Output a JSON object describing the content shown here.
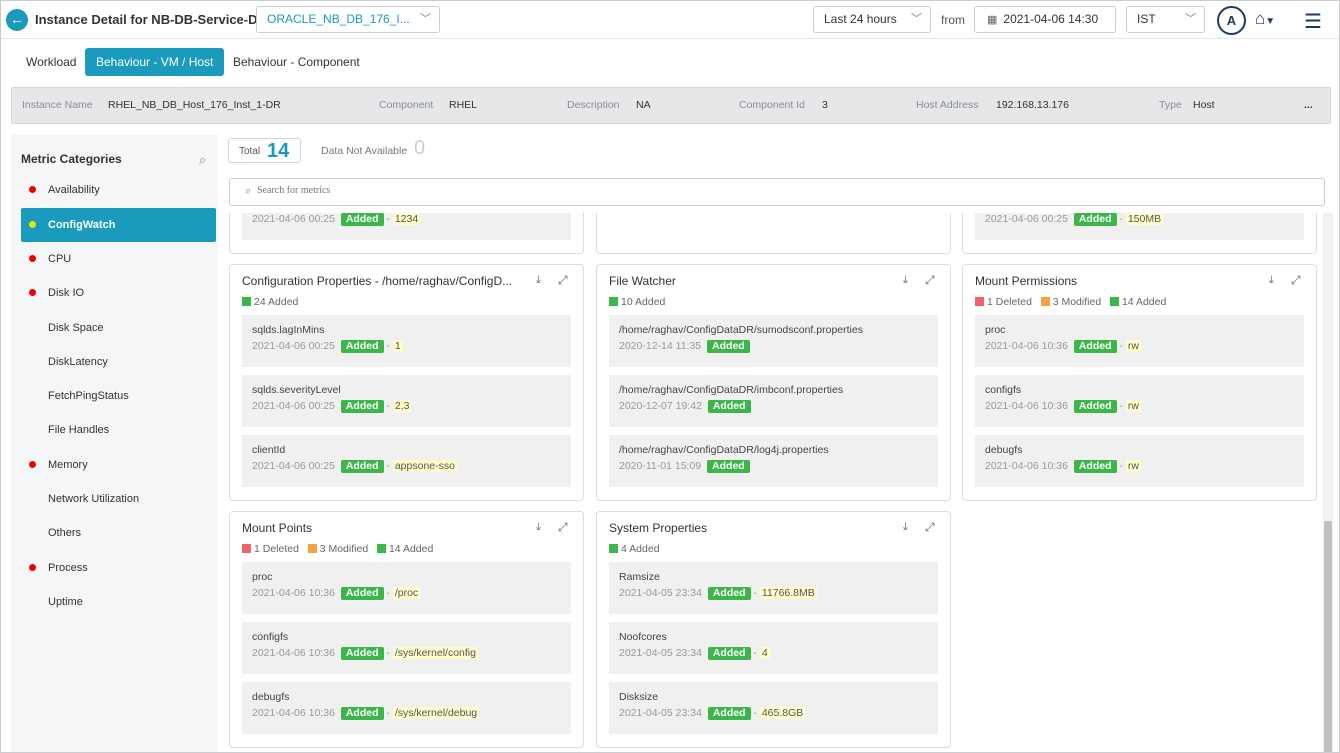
{
  "header": {
    "title": "Instance Detail for NB-DB-Service-DR",
    "instance_select": "ORACLE_NB_DB_176_I...",
    "time_range": "Last 24 hours",
    "from_label": "from",
    "from_date": "2021-04-06 14:30",
    "timezone": "IST",
    "avatar": "A"
  },
  "tabs": [
    "Workload",
    "Behaviour - VM / Host",
    "Behaviour - Component"
  ],
  "info": {
    "instance_name_key": "Instance Name",
    "instance_name": "RHEL_NB_DB_Host_176_Inst_1-DR",
    "component_key": "Component",
    "component": "RHEL",
    "description_key": "Description",
    "description": "NA",
    "component_id_key": "Component Id",
    "component_id": "3",
    "host_address_key": "Host Address",
    "host_address": "192.168.13.176",
    "type_key": "Type",
    "type": "Host",
    "more": "..."
  },
  "sidebar": {
    "title": "Metric Categories",
    "items": [
      {
        "label": "Availability",
        "dot": true
      },
      {
        "label": "ConfigWatch",
        "dot": true
      },
      {
        "label": "CPU",
        "dot": true
      },
      {
        "label": "Disk IO",
        "dot": true
      },
      {
        "label": "Disk Space",
        "dot": false
      },
      {
        "label": "DiskLatency",
        "dot": false
      },
      {
        "label": "FetchPingStatus",
        "dot": false
      },
      {
        "label": "File Handles",
        "dot": false
      },
      {
        "label": "Memory",
        "dot": true
      },
      {
        "label": "Network Utilization",
        "dot": false
      },
      {
        "label": "Others",
        "dot": false
      },
      {
        "label": "Process",
        "dot": true
      },
      {
        "label": "Uptime",
        "dot": false
      }
    ]
  },
  "summary": {
    "total_label": "Total",
    "total": "14",
    "dna_label": "Data Not Available",
    "dna": "0"
  },
  "search": {
    "placeholder": "Search for metrics"
  },
  "partial": [
    {
      "time": "2021-04-06 00:25",
      "badge": "Added",
      "value": "1234"
    },
    {
      "time": "2021-04-06 00:25",
      "badge": "Added",
      "value": "150MB"
    }
  ],
  "cards": {
    "config_props": {
      "title": "Configuration Properties - /home/raghav/ConfigD...",
      "added": "24 Added",
      "items": [
        {
          "name": "sqlds.lagInMins",
          "time": "2021-04-06 00:25",
          "badge": "Added",
          "value": "1"
        },
        {
          "name": "sqlds.severityLevel",
          "time": "2021-04-06 00:25",
          "badge": "Added",
          "value": "2,3"
        },
        {
          "name": "clientId",
          "time": "2021-04-06 00:25",
          "badge": "Added",
          "value": "appsone-sso"
        }
      ]
    },
    "file_watcher": {
      "title": "File Watcher",
      "added": "10 Added",
      "items": [
        {
          "name": "/home/raghav/ConfigDataDR/sumodsconf.properties",
          "time": "2020-12-14 11:35",
          "badge": "Added"
        },
        {
          "name": "/home/raghav/ConfigDataDR/imbconf.properties",
          "time": "2020-12-07 19:42",
          "badge": "Added"
        },
        {
          "name": "/home/raghav/ConfigDataDR/log4j.properties",
          "time": "2020-11-01 15:09",
          "badge": "Added"
        }
      ]
    },
    "mount_permissions": {
      "title": "Mount Permissions",
      "deleted": "1 Deleted",
      "modified": "3 Modified",
      "added": "14 Added",
      "items": [
        {
          "name": "proc",
          "time": "2021-04-06 10:36",
          "badge": "Added",
          "value": "rw"
        },
        {
          "name": "configfs",
          "time": "2021-04-06 10:36",
          "badge": "Added",
          "value": "rw"
        },
        {
          "name": "debugfs",
          "time": "2021-04-06 10:36",
          "badge": "Added",
          "value": "rw"
        }
      ]
    },
    "mount_points": {
      "title": "Mount Points",
      "deleted": "1 Deleted",
      "modified": "3 Modified",
      "added": "14 Added",
      "items": [
        {
          "name": "proc",
          "time": "2021-04-06 10:36",
          "badge": "Added",
          "value": "/proc"
        },
        {
          "name": "configfs",
          "time": "2021-04-06 10:36",
          "badge": "Added",
          "value": "/sys/kernel/config"
        },
        {
          "name": "debugfs",
          "time": "2021-04-06 10:36",
          "badge": "Added",
          "value": "/sys/kernel/debug"
        }
      ]
    },
    "system_properties": {
      "title": "System Properties",
      "added": "4 Added",
      "items": [
        {
          "name": "Ramsize",
          "time": "2021-04-05 23:34",
          "badge": "Added",
          "value": "11766.8MB"
        },
        {
          "name": "Noofcores",
          "time": "2021-04-05 23:34",
          "badge": "Added",
          "value": "4"
        },
        {
          "name": "Disksize",
          "time": "2021-04-05 23:34",
          "badge": "Added",
          "value": "465.8GB"
        }
      ]
    }
  },
  "colors": {
    "accent": "#1a9bbd",
    "added": "#3cb54a",
    "deleted": "#f0616b",
    "modified": "#f5a142",
    "alert_dot": "#e00000",
    "active_dot": "#e6e600"
  }
}
